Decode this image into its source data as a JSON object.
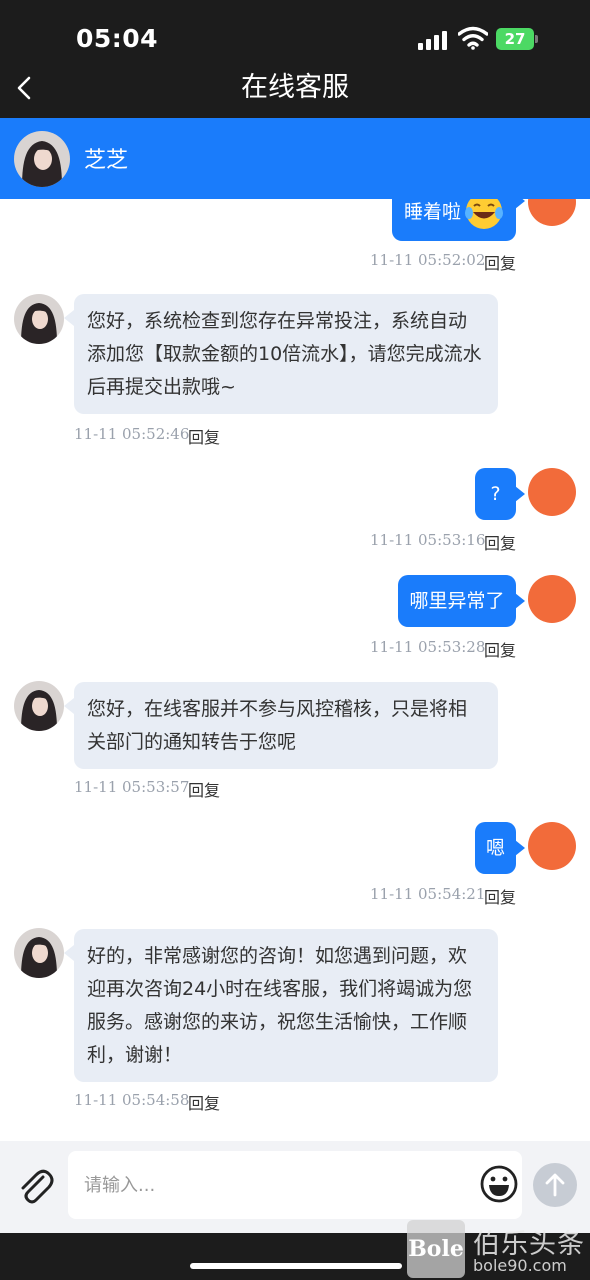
{
  "status_bar": {
    "time": "05:04",
    "battery": "27"
  },
  "nav": {
    "title": "在线客服"
  },
  "agent": {
    "name": "芝芝"
  },
  "messages": [
    {
      "from": "user",
      "text": "睡着啦",
      "time": "11-11 05:52:02",
      "reply": "回复",
      "emoji": "grinning-tears-emoji"
    },
    {
      "from": "agent",
      "text": "您好，系统检查到您存在异常投注，系统自动添加您【取款金额的10倍流水】，请您完成流水后再提交出款哦~",
      "time": "11-11 05:52:46",
      "reply": "回复"
    },
    {
      "from": "user",
      "text": "?",
      "time": "11-11 05:53:16",
      "reply": "回复"
    },
    {
      "from": "user",
      "text": "哪里异常了",
      "time": "11-11 05:53:28",
      "reply": "回复"
    },
    {
      "from": "agent",
      "text": "您好，在线客服并不参与风控稽核，只是将相关部门的通知转告于您呢",
      "time": "11-11 05:53:57",
      "reply": "回复"
    },
    {
      "from": "user",
      "text": "嗯",
      "time": "11-11 05:54:21",
      "reply": "回复"
    },
    {
      "from": "agent",
      "text": "好的，非常感谢您的咨询！如您遇到问题，欢迎再次咨询24小时在线客服，我们将竭诚为您服务。感谢您的来访，祝您生活愉快，工作顺利，谢谢！",
      "time": "11-11 05:54:58",
      "reply": "回复"
    }
  ],
  "input": {
    "placeholder": "请输入..."
  },
  "watermark": {
    "logo": "Bole",
    "name": "伯乐头条",
    "url": "bole90.com"
  },
  "colors": {
    "primary": "#1a7cfb",
    "user_avatar": "#f26b3a",
    "agent_bubble": "#e8edf5",
    "dark_bar": "#1c1c1c"
  }
}
